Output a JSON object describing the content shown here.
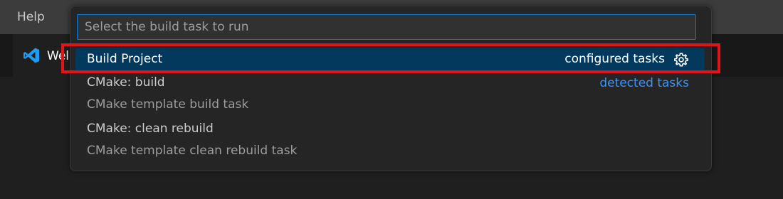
{
  "menubar": {
    "help": "Help"
  },
  "tab": {
    "label": "Wel",
    "icon": "vscode-logo"
  },
  "quickpick": {
    "placeholder": "Select the build task to run",
    "items": [
      {
        "label": "Build Project",
        "detail": "configured tasks",
        "icon": "gear-icon",
        "selected": true
      },
      {
        "label": "CMake: build",
        "detail": "detected tasks",
        "description": "CMake template build task"
      },
      {
        "label": "CMake: clean rebuild",
        "description": "CMake template clean rebuild task"
      }
    ]
  },
  "colors": {
    "accent": "#0a78d4",
    "selection": "#04395e",
    "link": "#3794ff",
    "highlight": "#e1141c"
  }
}
